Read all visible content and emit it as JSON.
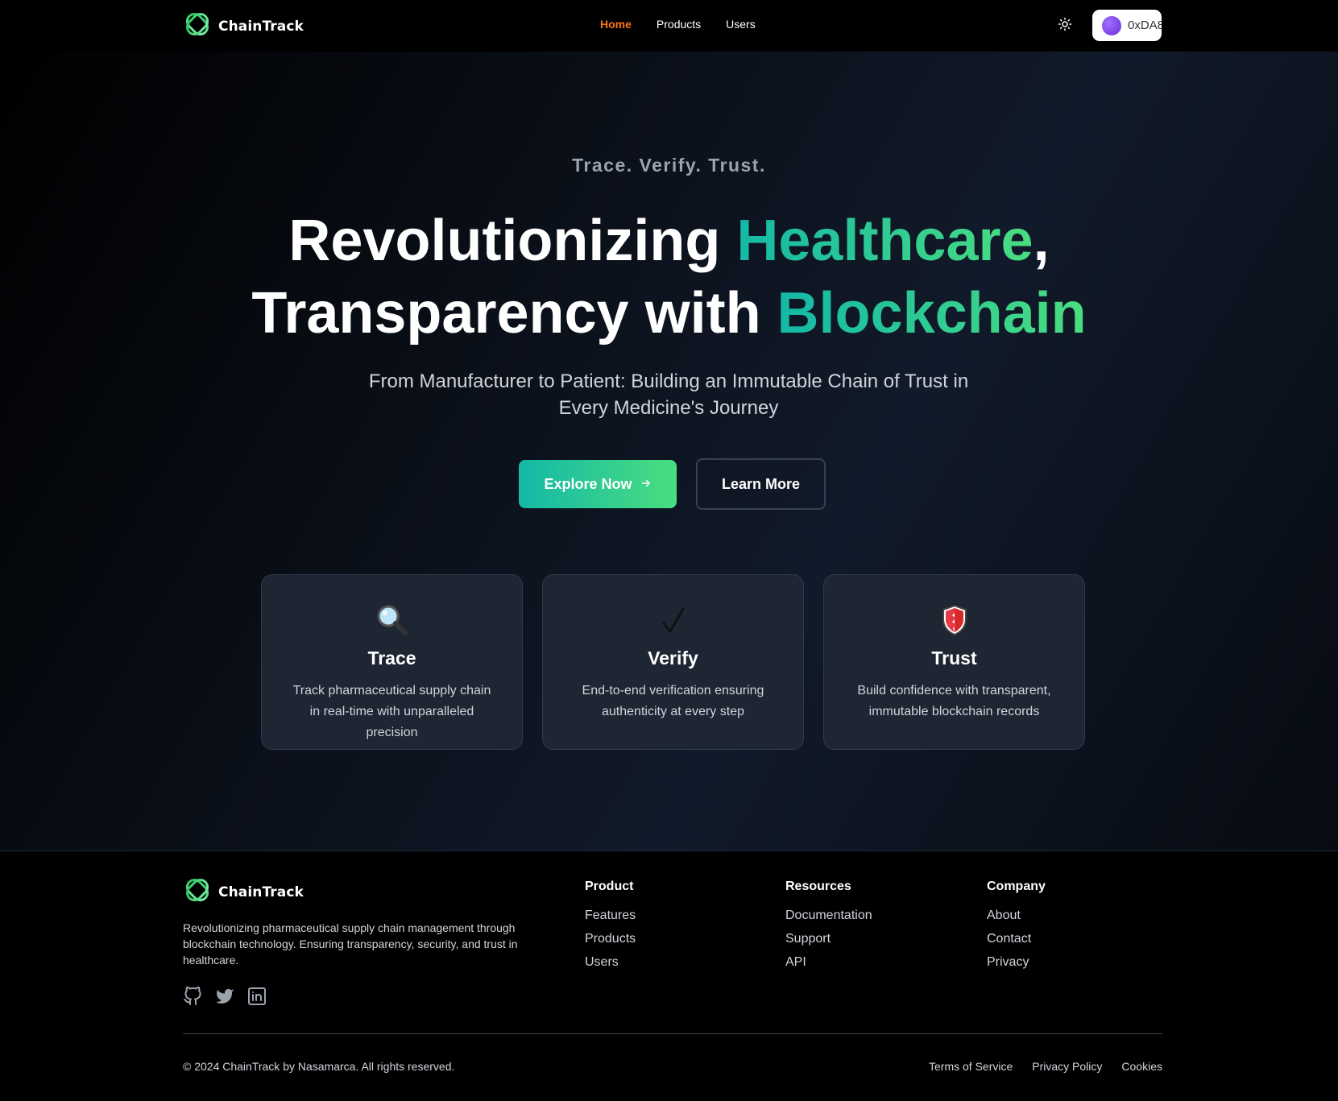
{
  "brand": {
    "name": "ChainTrack",
    "logo_icon": "chain-link-logo-icon",
    "accent_from": "#14b8a6",
    "accent_to": "#4ade80"
  },
  "nav": {
    "links": [
      {
        "label": "Home",
        "active": true
      },
      {
        "label": "Products",
        "active": false
      },
      {
        "label": "Users",
        "active": false
      }
    ],
    "active_color": "#f97316",
    "theme_icon": "sun-icon",
    "wallet": {
      "address": "0xDA8"
    }
  },
  "hero": {
    "tagline": "Trace. Verify. Trust.",
    "headline_line1_a": "Revolutionizing ",
    "headline_line1_b": "Healthcare",
    "headline_line1_c": ",",
    "headline_line2_a": "Transparency with ",
    "headline_line2_b": "Blockchain",
    "subhead": "From Manufacturer to Patient: Building an Immutable Chain of Trust in Every Medicine's Journey",
    "primary_button": "Explore Now",
    "primary_button_icon": "arrow-right-icon",
    "secondary_button": "Learn More"
  },
  "features": [
    {
      "icon": "magnifying-glass-icon",
      "glyph": "🔍",
      "title": "Trace",
      "desc": "Track pharmaceutical supply chain in real-time with unparalleled precision"
    },
    {
      "icon": "check-mark-icon",
      "glyph": "✓",
      "title": "Verify",
      "desc": "End-to-end verification ensuring authenticity at every step"
    },
    {
      "icon": "shield-icon",
      "glyph": "🛡",
      "title": "Trust",
      "desc": "Build confidence with transparent, immutable blockchain records"
    }
  ],
  "footer": {
    "description": "Revolutionizing pharmaceutical supply chain management through blockchain technology. Ensuring transparency, security, and trust in healthcare.",
    "social": [
      "github-icon",
      "twitter-icon",
      "linkedin-icon"
    ],
    "columns": [
      {
        "title": "Product",
        "links": [
          "Features",
          "Products",
          "Users"
        ]
      },
      {
        "title": "Resources",
        "links": [
          "Documentation",
          "Support",
          "API"
        ]
      },
      {
        "title": "Company",
        "links": [
          "About",
          "Contact",
          "Privacy"
        ]
      }
    ],
    "copyright": "© 2024 ChainTrack by Nasamarca. All rights reserved.",
    "legal": [
      "Terms of Service",
      "Privacy Policy",
      "Cookies"
    ]
  }
}
